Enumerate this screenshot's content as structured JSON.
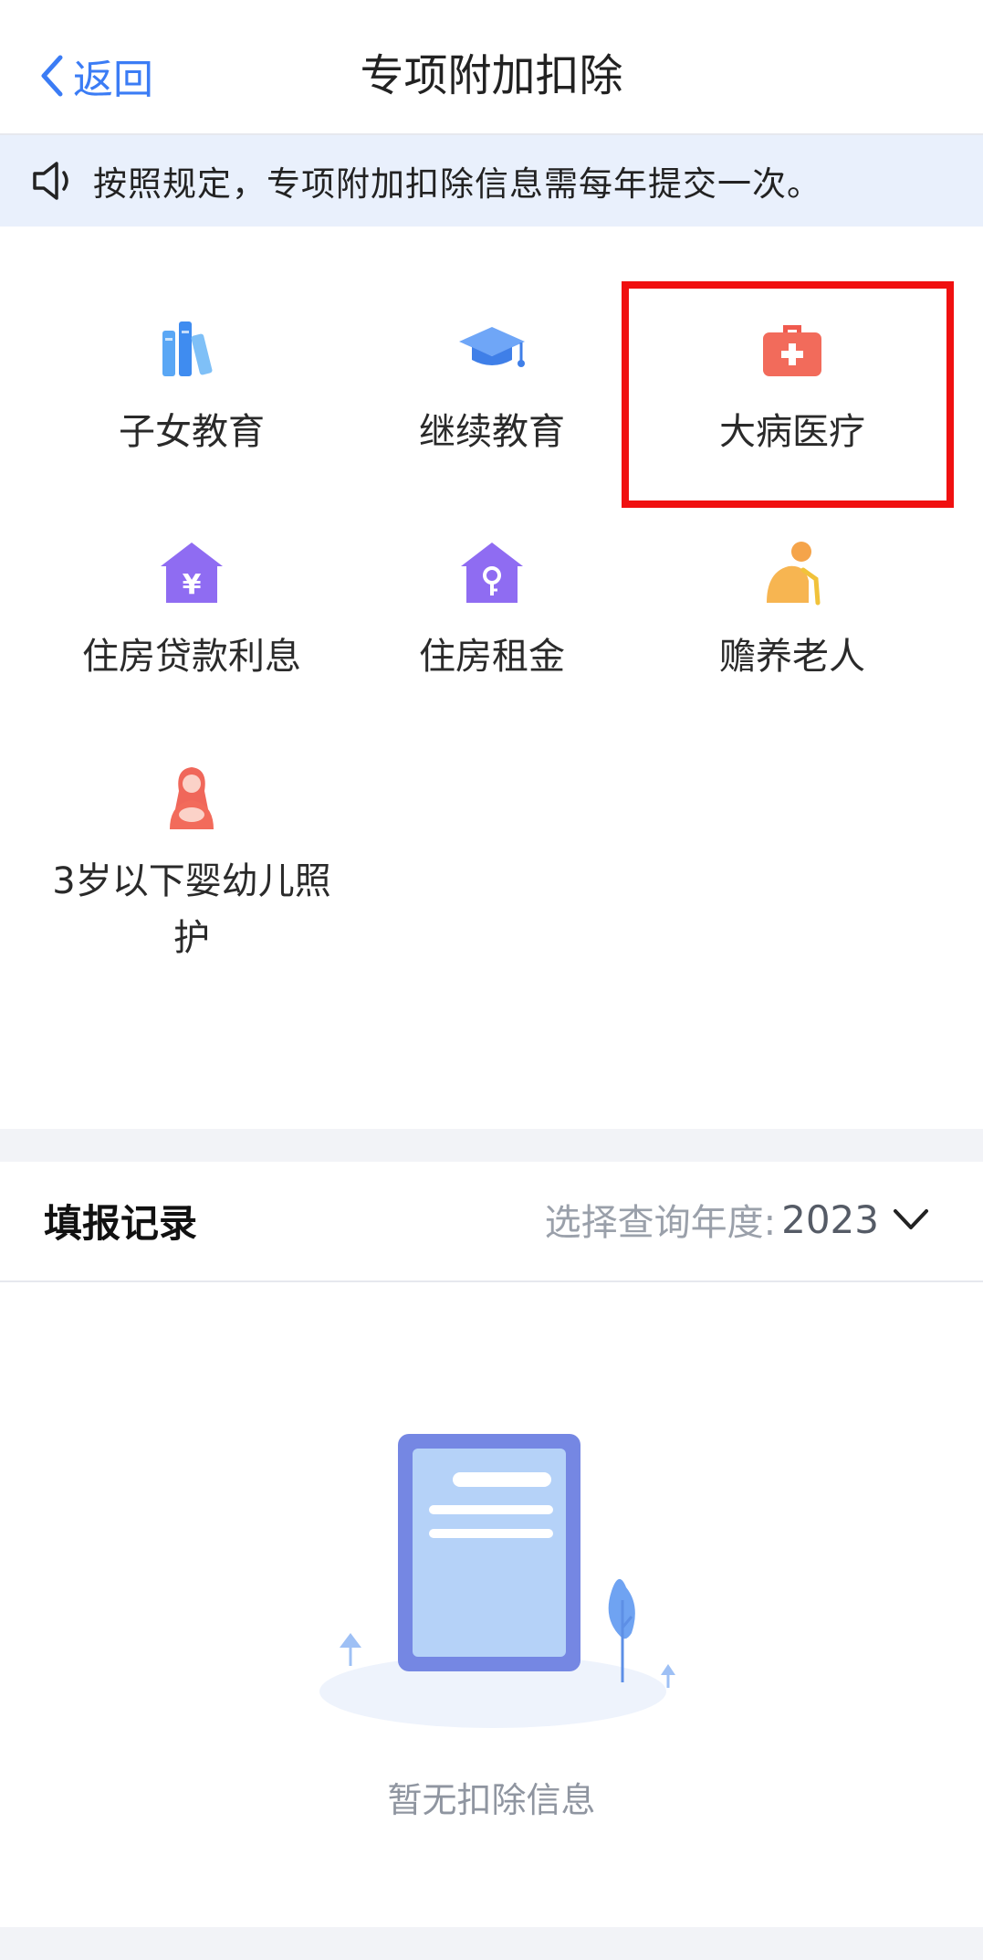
{
  "header": {
    "back_label": "返回",
    "title": "专项附加扣除"
  },
  "notice": {
    "text": "按照规定，专项附加扣除信息需每年提交一次。"
  },
  "deductions": [
    {
      "label": "子女教育",
      "icon": "books-icon"
    },
    {
      "label": "继续教育",
      "icon": "graduation-cap-icon"
    },
    {
      "label": "大病医疗",
      "icon": "medical-kit-icon",
      "highlighted": true
    },
    {
      "label": "住房贷款利息",
      "icon": "house-yen-icon"
    },
    {
      "label": "住房租金",
      "icon": "house-key-icon"
    },
    {
      "label": "赡养老人",
      "icon": "elderly-person-icon"
    },
    {
      "label": "3岁以下婴幼儿照护",
      "icon": "mother-baby-icon"
    }
  ],
  "records": {
    "title": "填报记录",
    "year_prompt": "选择查询年度:",
    "year_value": "2023",
    "empty_text": "暂无扣除信息"
  },
  "colors": {
    "accent": "#3b7cf5",
    "highlight_border": "#f01010",
    "notice_bg": "#e9f0fc"
  }
}
